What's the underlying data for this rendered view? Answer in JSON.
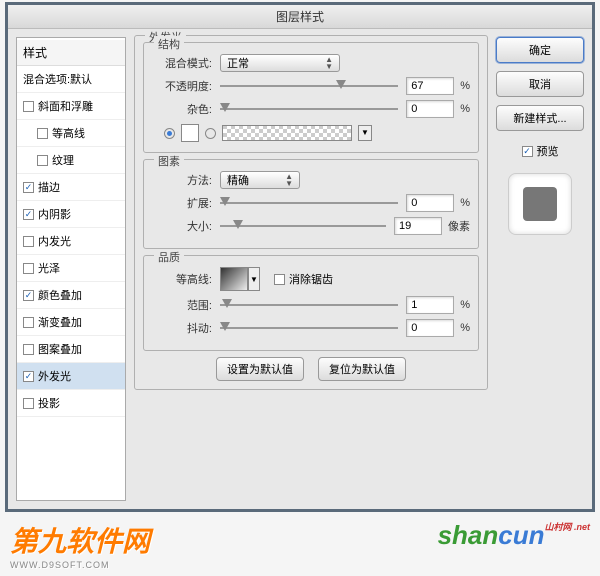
{
  "title": "图层样式",
  "sidebar": {
    "header": "样式",
    "items": [
      {
        "label": "混合选项:默认",
        "checked": null
      },
      {
        "label": "斜面和浮雕",
        "checked": false
      },
      {
        "label": "等高线",
        "checked": false,
        "indent": true
      },
      {
        "label": "纹理",
        "checked": false,
        "indent": true
      },
      {
        "label": "描边",
        "checked": true
      },
      {
        "label": "内阴影",
        "checked": true
      },
      {
        "label": "内发光",
        "checked": false
      },
      {
        "label": "光泽",
        "checked": false
      },
      {
        "label": "颜色叠加",
        "checked": true
      },
      {
        "label": "渐变叠加",
        "checked": false
      },
      {
        "label": "图案叠加",
        "checked": false
      },
      {
        "label": "外发光",
        "checked": true,
        "selected": true
      },
      {
        "label": "投影",
        "checked": false
      }
    ]
  },
  "panel": {
    "title": "外发光",
    "structure": {
      "legend": "结构",
      "blend_label": "混合模式:",
      "blend_value": "正常",
      "opacity_label": "不透明度:",
      "opacity_value": "67",
      "opacity_unit": "%",
      "noise_label": "杂色:",
      "noise_value": "0",
      "noise_unit": "%"
    },
    "elements": {
      "legend": "图素",
      "method_label": "方法:",
      "method_value": "精确",
      "spread_label": "扩展:",
      "spread_value": "0",
      "spread_unit": "%",
      "size_label": "大小:",
      "size_value": "19",
      "size_unit": "像素"
    },
    "quality": {
      "legend": "品质",
      "contour_label": "等高线:",
      "antialias_label": "消除锯齿",
      "range_label": "范围:",
      "range_value": "1",
      "range_unit": "%",
      "jitter_label": "抖动:",
      "jitter_value": "0",
      "jitter_unit": "%"
    },
    "reset_btn": "设置为默认值",
    "revert_btn": "复位为默认值"
  },
  "buttons": {
    "ok": "确定",
    "cancel": "取消",
    "new_style": "新建样式...",
    "preview": "预览"
  },
  "watermark": {
    "left_main": "第九软件网",
    "left_sub": "WWW.D9SOFT.COM",
    "right_g": "shan",
    "right_b": "cun",
    "right_small": "山村网 .net"
  }
}
